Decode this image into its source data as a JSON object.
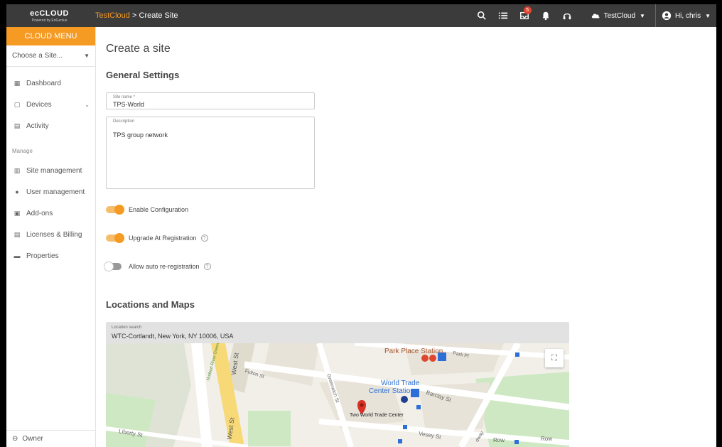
{
  "app": {
    "logo_text": "ecCLOUD",
    "logo_sub": "Powered by EnGenius"
  },
  "breadcrumb": {
    "org": "TestCloud",
    "separator": ">",
    "current": "Create Site"
  },
  "topbar": {
    "inbox_badge": "5",
    "org_name": "TestCloud",
    "greeting": "Hi, chris"
  },
  "sidebar": {
    "menu_title": "CLOUD MENU",
    "site_chooser": "Choose a Site...",
    "items": [
      {
        "label": "Dashboard",
        "icon": "dashboard-icon"
      },
      {
        "label": "Devices",
        "icon": "devices-icon"
      },
      {
        "label": "Activity",
        "icon": "activity-icon"
      }
    ],
    "manage_label": "Manage",
    "manage_items": [
      {
        "label": "Site management",
        "icon": "site-icon"
      },
      {
        "label": "User management",
        "icon": "user-icon"
      },
      {
        "label": "Add-ons",
        "icon": "addons-icon"
      },
      {
        "label": "Licenses & Billing",
        "icon": "license-icon"
      },
      {
        "label": "Properties",
        "icon": "properties-icon"
      }
    ],
    "owner": "Owner"
  },
  "main": {
    "page_title": "Create a site",
    "general_title": "General Settings",
    "site_name_label": "Site name *",
    "site_name_value": "TPS-World",
    "description_label": "Description",
    "description_value": "TPS group network",
    "toggles": [
      {
        "label": "Enable Configuration",
        "on": true,
        "help": false
      },
      {
        "label": "Upgrade At Registration",
        "on": true,
        "help": true
      },
      {
        "label": "Allow auto re-registration",
        "on": false,
        "help": true
      }
    ],
    "locations_title": "Locations and Maps",
    "location_label": "Location search",
    "location_value": "WTC-Cortlandt, New York, NY 10006, USA"
  },
  "map": {
    "labels": {
      "park_place": "Park Place Station",
      "park_pl": "Park Pl",
      "wtc_station_1": "World Trade",
      "wtc_station_2": "Center Station",
      "barclay": "Barclay St",
      "fulton": "Fulton St",
      "greenwich": "Greenwich St",
      "west_st_1": "West St",
      "west_st_2": "West St",
      "hudson": "Hudson River Greenway",
      "two_wtc": "Two World Trade Center",
      "vesey": "Vesey St",
      "liberty": "Liberty St",
      "row1": "Row",
      "row2": "Row",
      "broadway": "dway"
    },
    "colors": {
      "land": "#f2efe9",
      "building": "#e8e3d8",
      "park": "#cde8c2",
      "highway": "#f7d977",
      "marker": "#d93025",
      "transit": "#2c6fd6"
    }
  }
}
